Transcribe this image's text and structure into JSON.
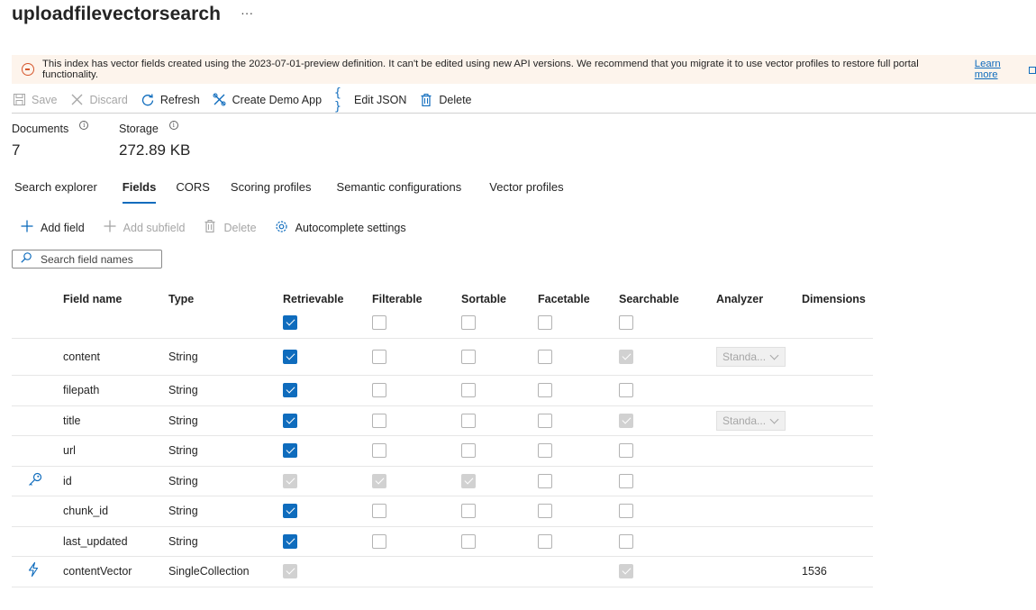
{
  "page": {
    "title": "uploadfilevectorsearch",
    "more": "···"
  },
  "banner": {
    "text": "This index has vector fields created using the 2023-07-01-preview definition. It can't be edited using new API versions. We recommend that you migrate it to use vector profiles to restore full portal functionality.",
    "link": "Learn more",
    "color": "#d6562c"
  },
  "toolbar": {
    "save": "Save",
    "discard": "Discard",
    "refresh": "Refresh",
    "create_demo_app": "Create Demo App",
    "edit_json": "Edit JSON",
    "delete": "Delete"
  },
  "stats": {
    "documents_label": "Documents",
    "documents_value": "7",
    "storage_label": "Storage",
    "storage_value": "272.89 KB"
  },
  "tabs": [
    {
      "label": "Search explorer",
      "active": false
    },
    {
      "label": "Fields",
      "active": true
    },
    {
      "label": "CORS",
      "active": false
    },
    {
      "label": "Scoring profiles",
      "active": false
    },
    {
      "label": "Semantic configurations",
      "active": false
    },
    {
      "label": "Vector profiles",
      "active": false
    }
  ],
  "commands": {
    "add_field": "Add field",
    "add_subfield": "Add subfield",
    "delete": "Delete",
    "autocomplete": "Autocomplete settings"
  },
  "search": {
    "placeholder": "Search field names"
  },
  "columns": {
    "field_name": "Field name",
    "type": "Type",
    "retrievable": "Retrievable",
    "filterable": "Filterable",
    "sortable": "Sortable",
    "facetable": "Facetable",
    "searchable": "Searchable",
    "analyzer": "Analyzer",
    "dimensions": "Dimensions"
  },
  "header_checks": {
    "retrievable": "on",
    "filterable": "off",
    "sortable": "off",
    "facetable": "off",
    "searchable": "off"
  },
  "rows": [
    {
      "name": "content",
      "type": "String",
      "icon": "",
      "retrievable": "on",
      "filterable": "off",
      "sortable": "off",
      "facetable": "off",
      "searchable": "dis",
      "analyzer": "Standa...",
      "dimensions": ""
    },
    {
      "name": "filepath",
      "type": "String",
      "icon": "",
      "retrievable": "on",
      "filterable": "off",
      "sortable": "off",
      "facetable": "off",
      "searchable": "off",
      "analyzer": "",
      "dimensions": ""
    },
    {
      "name": "title",
      "type": "String",
      "icon": "",
      "retrievable": "on",
      "filterable": "off",
      "sortable": "off",
      "facetable": "off",
      "searchable": "dis",
      "analyzer": "Standa...",
      "dimensions": ""
    },
    {
      "name": "url",
      "type": "String",
      "icon": "",
      "retrievable": "on",
      "filterable": "off",
      "sortable": "off",
      "facetable": "off",
      "searchable": "off",
      "analyzer": "",
      "dimensions": ""
    },
    {
      "name": "id",
      "type": "String",
      "icon": "key-icon",
      "retrievable": "dis",
      "filterable": "dis",
      "sortable": "dis",
      "facetable": "off",
      "searchable": "off",
      "analyzer": "",
      "dimensions": ""
    },
    {
      "name": "chunk_id",
      "type": "String",
      "icon": "",
      "retrievable": "on",
      "filterable": "off",
      "sortable": "off",
      "facetable": "off",
      "searchable": "off",
      "analyzer": "",
      "dimensions": ""
    },
    {
      "name": "last_updated",
      "type": "String",
      "icon": "",
      "retrievable": "on",
      "filterable": "off",
      "sortable": "off",
      "facetable": "off",
      "searchable": "off",
      "analyzer": "",
      "dimensions": ""
    },
    {
      "name": "contentVector",
      "type": "SingleCollection",
      "icon": "lightning-icon",
      "retrievable": "dis",
      "filterable": "none",
      "sortable": "none",
      "facetable": "none",
      "searchable": "dis",
      "analyzer": "",
      "dimensions": "1536"
    }
  ]
}
